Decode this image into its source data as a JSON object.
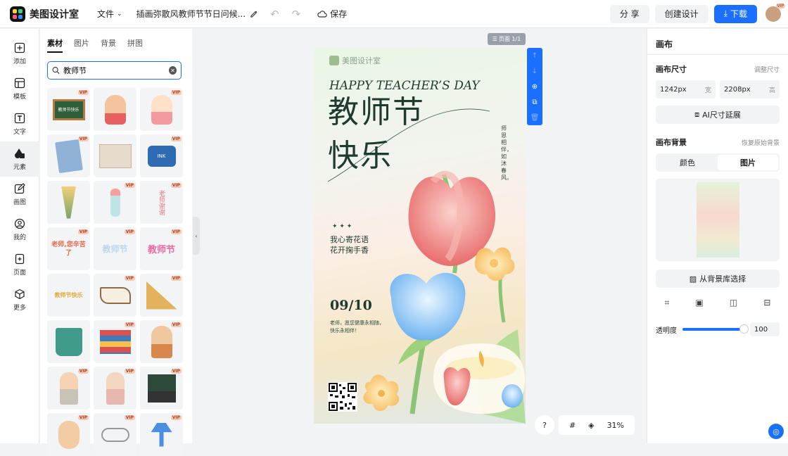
{
  "app": {
    "name": "美图设计室"
  },
  "header": {
    "file_menu": "文件",
    "doc_title": "插画弥散风教师节节日问候...",
    "save_label": "保存",
    "share_label": "分 享",
    "create_label": "创建设计",
    "download_label": "下载",
    "avatar_badge": "VIP"
  },
  "leftnav": {
    "items": [
      {
        "label": "添加",
        "icon": "plus-square-icon"
      },
      {
        "label": "模板",
        "icon": "template-icon"
      },
      {
        "label": "文字",
        "icon": "text-icon"
      },
      {
        "label": "元素",
        "icon": "shapes-icon"
      },
      {
        "label": "画图",
        "icon": "pencil-icon"
      },
      {
        "label": "我的",
        "icon": "user-icon"
      },
      {
        "label": "页面",
        "icon": "page-add-icon"
      },
      {
        "label": "更多",
        "icon": "cube-icon"
      }
    ]
  },
  "assets": {
    "tabs": [
      "素材",
      "图片",
      "背景",
      "拼图"
    ],
    "search_value": "教师节",
    "vip_tag": "VIP",
    "cells": [
      {
        "vip": true,
        "text": "教师节快乐",
        "kind": "board"
      },
      {
        "vip": false,
        "text": "",
        "kind": "teacher"
      },
      {
        "vip": true,
        "text": "",
        "kind": "girl"
      },
      {
        "vip": true,
        "text": "",
        "kind": "notebook"
      },
      {
        "vip": false,
        "text": "",
        "kind": "paper"
      },
      {
        "vip": true,
        "text": "INK",
        "kind": "ink"
      },
      {
        "vip": false,
        "text": "",
        "kind": "bouquet"
      },
      {
        "vip": true,
        "text": "",
        "kind": "vase"
      },
      {
        "vip": true,
        "text": "老师谢谢",
        "kind": "vtext"
      },
      {
        "vip": true,
        "text": "老师,您辛苦了",
        "kind": "colortext"
      },
      {
        "vip": true,
        "text": "教师节",
        "kind": "ghosttext"
      },
      {
        "vip": true,
        "text": "教师节",
        "kind": "pinktext"
      },
      {
        "vip": false,
        "text": "教师节快乐",
        "kind": "yellowtext"
      },
      {
        "vip": true,
        "text": "",
        "kind": "book"
      },
      {
        "vip": true,
        "text": "",
        "kind": "ruler"
      },
      {
        "vip": false,
        "text": "",
        "kind": "mug"
      },
      {
        "vip": true,
        "text": "",
        "kind": "books"
      },
      {
        "vip": true,
        "text": "",
        "kind": "teacher2"
      },
      {
        "vip": true,
        "text": "",
        "kind": "man"
      },
      {
        "vip": true,
        "text": "",
        "kind": "woman"
      },
      {
        "vip": true,
        "text": "",
        "kind": "blackboardman"
      },
      {
        "vip": true,
        "text": "",
        "kind": "teacher3"
      },
      {
        "vip": true,
        "text": "",
        "kind": "glasses"
      },
      {
        "vip": true,
        "text": "",
        "kind": "lamp"
      }
    ]
  },
  "canvas": {
    "page_label": "页面 1/1",
    "zoom": "31%",
    "help": "?"
  },
  "poster": {
    "brand": "美图设计室",
    "headline_en": "HAPPY TEACHER’S DAY",
    "headline_cn_1": "教师节",
    "headline_cn_2": "快乐",
    "vertical": "师恩相伴，如沐春风。",
    "stars": "✦ ✦ ✦",
    "line1": "我心寄花语",
    "line2": "花开掬手香",
    "date": "09/10",
    "wish1": "老师，愿您健康永相随，",
    "wish2": "快乐永相伴！"
  },
  "rightpanel": {
    "title": "画布",
    "size_heading": "画布尺寸",
    "size_adjust": "调整尺寸",
    "width_value": "1242px",
    "width_unit": "宽",
    "height_value": "2208px",
    "height_unit": "高",
    "ai_extend": "AI尺寸延展",
    "bg_heading": "画布背景",
    "bg_restore": "恢复原始背景",
    "seg_color": "颜色",
    "seg_image": "图片",
    "from_library": "从背景库选择",
    "opacity_label": "透明度",
    "opacity_value": "100"
  },
  "colors": {
    "accent": "#1a6fff",
    "poster_green": "#2d4a3a"
  }
}
